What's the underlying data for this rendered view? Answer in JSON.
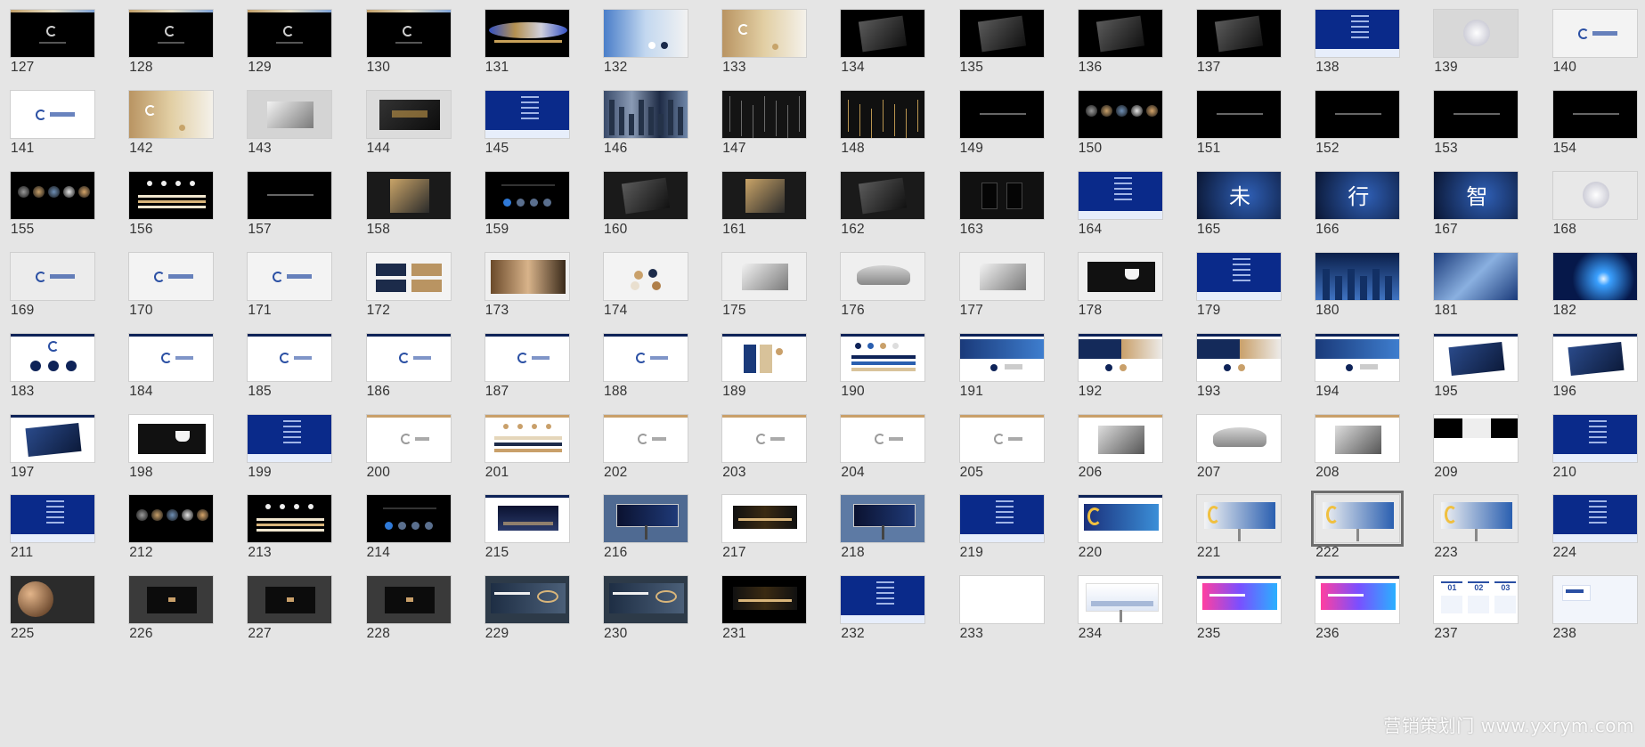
{
  "watermark": "营销策划门 www.yxrym.com",
  "selected_slide": 222,
  "slides": [
    {
      "n": "127",
      "bg": "#000000",
      "k": "logo-dark"
    },
    {
      "n": "128",
      "bg": "#000000",
      "k": "logo-dark"
    },
    {
      "n": "129",
      "bg": "#000000",
      "k": "logo-dark"
    },
    {
      "n": "130",
      "bg": "#000000",
      "k": "logo-dark"
    },
    {
      "n": "131",
      "bg": "#000000",
      "k": "wave"
    },
    {
      "n": "132",
      "bg": "#9fb6d6",
      "k": "gradient-card"
    },
    {
      "n": "133",
      "bg": "#c9a972",
      "k": "gold-card"
    },
    {
      "n": "134",
      "bg": "#000000",
      "k": "mock"
    },
    {
      "n": "135",
      "bg": "#000000",
      "k": "mock"
    },
    {
      "n": "136",
      "bg": "#000000",
      "k": "mock"
    },
    {
      "n": "137",
      "bg": "#000000",
      "k": "mock"
    },
    {
      "n": "138",
      "bg": "#0a2a8a",
      "k": "blue-list"
    },
    {
      "n": "139",
      "bg": "#d8d8d8",
      "k": "sphere"
    },
    {
      "n": "140",
      "bg": "#f3f3f3",
      "k": "logo-light"
    },
    {
      "n": "141",
      "bg": "#ffffff",
      "k": "logo-light"
    },
    {
      "n": "142",
      "bg": "#e0e0e0",
      "k": "gold-card"
    },
    {
      "n": "143",
      "bg": "#d4d4d4",
      "k": "mock-light"
    },
    {
      "n": "144",
      "bg": "#dcdcdc",
      "k": "mock-dark-in"
    },
    {
      "n": "145",
      "bg": "#0a2a8a",
      "k": "blue-list"
    },
    {
      "n": "146",
      "bg": "#6f7c93",
      "k": "city"
    },
    {
      "n": "147",
      "bg": "#141414",
      "k": "lines"
    },
    {
      "n": "148",
      "bg": "#101010",
      "k": "lines-gold"
    },
    {
      "n": "149",
      "bg": "#000000",
      "k": "text-dark"
    },
    {
      "n": "150",
      "bg": "#000000",
      "k": "spheres"
    },
    {
      "n": "151",
      "bg": "#000000",
      "k": "text-dark"
    },
    {
      "n": "152",
      "bg": "#000000",
      "k": "text-dark"
    },
    {
      "n": "153",
      "bg": "#000000",
      "k": "text-dark"
    },
    {
      "n": "154",
      "bg": "#000000",
      "k": "text-dark"
    },
    {
      "n": "155",
      "bg": "#000000",
      "k": "spheres"
    },
    {
      "n": "156",
      "bg": "#000000",
      "k": "bars"
    },
    {
      "n": "157",
      "bg": "#000000",
      "k": "text-dark"
    },
    {
      "n": "158",
      "bg": "#1a1a1a",
      "k": "mock-gold"
    },
    {
      "n": "159",
      "bg": "#000000",
      "k": "dots-blue"
    },
    {
      "n": "160",
      "bg": "#1a1a1a",
      "k": "mock"
    },
    {
      "n": "161",
      "bg": "#1a1a1a",
      "k": "mock-gold"
    },
    {
      "n": "162",
      "bg": "#1a1a1a",
      "k": "mock"
    },
    {
      "n": "163",
      "bg": "#111111",
      "k": "cups"
    },
    {
      "n": "164",
      "bg": "#0a2a8a",
      "k": "blue-list"
    },
    {
      "n": "165",
      "bg": "#0d1a3a",
      "k": "kanji",
      "t": "未"
    },
    {
      "n": "166",
      "bg": "#0d1a3a",
      "k": "kanji",
      "t": "行"
    },
    {
      "n": "167",
      "bg": "#0d1a2a",
      "k": "kanji",
      "t": "智"
    },
    {
      "n": "168",
      "bg": "#e8e8e8",
      "k": "sphere"
    },
    {
      "n": "169",
      "bg": "#ececec",
      "k": "logo-light"
    },
    {
      "n": "170",
      "bg": "#f3f3f3",
      "k": "logo-light"
    },
    {
      "n": "171",
      "bg": "#f3f3f3",
      "k": "logo-light"
    },
    {
      "n": "172",
      "bg": "#f3f3f3",
      "k": "cards"
    },
    {
      "n": "173",
      "bg": "#efefef",
      "k": "photo-warm"
    },
    {
      "n": "174",
      "bg": "#f3f3f3",
      "k": "dots-palette"
    },
    {
      "n": "175",
      "bg": "#efefef",
      "k": "mock-light"
    },
    {
      "n": "176",
      "bg": "#efefef",
      "k": "umbrella"
    },
    {
      "n": "177",
      "bg": "#efefef",
      "k": "mock-light"
    },
    {
      "n": "178",
      "bg": "#efefef",
      "k": "cup"
    },
    {
      "n": "179",
      "bg": "#0a2a8a",
      "k": "blue-list"
    },
    {
      "n": "180",
      "bg": "#1d3a6a",
      "k": "blue-city"
    },
    {
      "n": "181",
      "bg": "#2b4e8c",
      "k": "blue-swirl"
    },
    {
      "n": "182",
      "bg": "#06184a",
      "k": "blue-burst"
    },
    {
      "n": "183",
      "bg": "#ffffff",
      "k": "spheres-light"
    },
    {
      "n": "184",
      "bg": "#ffffff",
      "k": "logo-white"
    },
    {
      "n": "185",
      "bg": "#ffffff",
      "k": "logo-white"
    },
    {
      "n": "186",
      "bg": "#ffffff",
      "k": "logo-white"
    },
    {
      "n": "187",
      "bg": "#ffffff",
      "k": "logo-white"
    },
    {
      "n": "188",
      "bg": "#ffffff",
      "k": "logo-white"
    },
    {
      "n": "189",
      "bg": "#ffffff",
      "k": "palette"
    },
    {
      "n": "190",
      "bg": "#ffffff",
      "k": "bars-light"
    },
    {
      "n": "191",
      "bg": "#ffffff",
      "k": "split-blue"
    },
    {
      "n": "192",
      "bg": "#ffffff",
      "k": "split-navy"
    },
    {
      "n": "193",
      "bg": "#ffffff",
      "k": "split-navy"
    },
    {
      "n": "194",
      "bg": "#ffffff",
      "k": "split-blue"
    },
    {
      "n": "195",
      "bg": "#ffffff",
      "k": "navy-card"
    },
    {
      "n": "196",
      "bg": "#ffffff",
      "k": "navy-card"
    },
    {
      "n": "197",
      "bg": "#ffffff",
      "k": "navy-card"
    },
    {
      "n": "198",
      "bg": "#ffffff",
      "k": "cup"
    },
    {
      "n": "199",
      "bg": "#0a2a8a",
      "k": "blue-list"
    },
    {
      "n": "200",
      "bg": "#ffffff",
      "k": "logo-gold-line"
    },
    {
      "n": "201",
      "bg": "#ffffff",
      "k": "bars-gold-line"
    },
    {
      "n": "202",
      "bg": "#ffffff",
      "k": "logo-gold-line"
    },
    {
      "n": "203",
      "bg": "#ffffff",
      "k": "logo-gold-line"
    },
    {
      "n": "204",
      "bg": "#ffffff",
      "k": "logo-gold-line"
    },
    {
      "n": "205",
      "bg": "#ffffff",
      "k": "logo-gold-line"
    },
    {
      "n": "206",
      "bg": "#ffffff",
      "k": "mock-gold-line"
    },
    {
      "n": "207",
      "bg": "#ffffff",
      "k": "umbrella"
    },
    {
      "n": "208",
      "bg": "#ffffff",
      "k": "mock-gold-line"
    },
    {
      "n": "209",
      "bg": "#ffffff",
      "k": "tri-panel"
    },
    {
      "n": "210",
      "bg": "#0a2a8a",
      "k": "blue-list"
    },
    {
      "n": "211",
      "bg": "#0a2a8a",
      "k": "blue-list"
    },
    {
      "n": "212",
      "bg": "#000000",
      "k": "spheres"
    },
    {
      "n": "213",
      "bg": "#000000",
      "k": "bars"
    },
    {
      "n": "214",
      "bg": "#000000",
      "k": "dots-blue"
    },
    {
      "n": "215",
      "bg": "#ffffff",
      "k": "billboard-city"
    },
    {
      "n": "216",
      "bg": "#4f6a92",
      "k": "billboard-sky"
    },
    {
      "n": "217",
      "bg": "#ffffff",
      "k": "billboard-night"
    },
    {
      "n": "218",
      "bg": "#5d7aa4",
      "k": "billboard-sky"
    },
    {
      "n": "219",
      "bg": "#0a2a8a",
      "k": "blue-list"
    },
    {
      "n": "220",
      "bg": "#ffffff",
      "k": "banner-blue"
    },
    {
      "n": "221",
      "bg": "#e8e8e8",
      "k": "billboard-blue"
    },
    {
      "n": "222",
      "bg": "#e8e8e8",
      "k": "billboard-blue"
    },
    {
      "n": "223",
      "bg": "#e8e8e8",
      "k": "billboard-blue"
    },
    {
      "n": "224",
      "bg": "#0a2a8a",
      "k": "blue-list"
    },
    {
      "n": "225",
      "bg": "#2b2b2b",
      "k": "planet"
    },
    {
      "n": "226",
      "bg": "#3a3a3a",
      "k": "dark-frame"
    },
    {
      "n": "227",
      "bg": "#3a3a3a",
      "k": "dark-frame"
    },
    {
      "n": "228",
      "bg": "#3a3a3a",
      "k": "dark-frame"
    },
    {
      "n": "229",
      "bg": "#2d3a48",
      "k": "gold-banner"
    },
    {
      "n": "230",
      "bg": "#2d3a48",
      "k": "gold-banner"
    },
    {
      "n": "231",
      "bg": "#000000",
      "k": "billboard-night"
    },
    {
      "n": "232",
      "bg": "#0a2a8a",
      "k": "blue-list"
    },
    {
      "n": "233",
      "bg": "#ffffff",
      "k": "blank"
    },
    {
      "n": "234",
      "bg": "#ffffff",
      "k": "billboard-white"
    },
    {
      "n": "235",
      "bg": "#ffffff",
      "k": "banner-pink"
    },
    {
      "n": "236",
      "bg": "#ffffff",
      "k": "banner-pink"
    },
    {
      "n": "237",
      "bg": "#ffffff",
      "k": "steps",
      "s": [
        "01",
        "02",
        "03"
      ]
    },
    {
      "n": "238",
      "bg": "#f2f5fb",
      "k": "logo-panel"
    }
  ]
}
